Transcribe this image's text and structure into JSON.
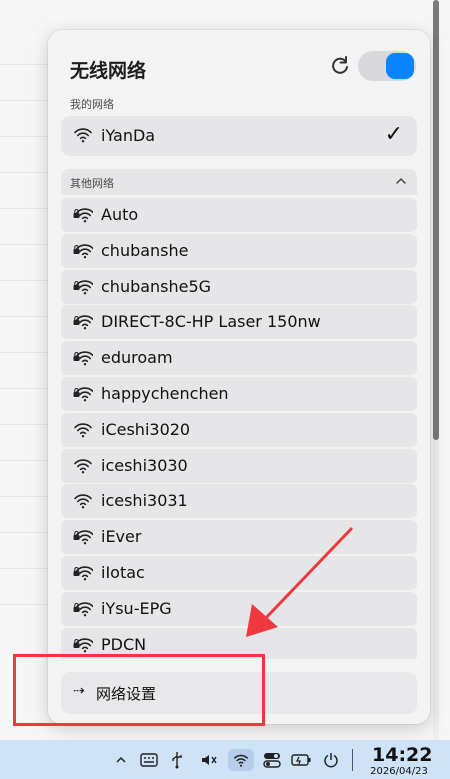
{
  "panel": {
    "title": "无线网络",
    "wifi_enabled": true,
    "accent_color": "#0a84ff"
  },
  "my_networks": {
    "label": "我的网络",
    "items": [
      {
        "name": "iYanDa",
        "connected": true,
        "secured": false
      }
    ]
  },
  "other_networks": {
    "label": "其他网络",
    "collapsed": false,
    "items": [
      {
        "name": "Auto",
        "secured": true
      },
      {
        "name": "chubanshe",
        "secured": true
      },
      {
        "name": "chubanshe5G",
        "secured": true
      },
      {
        "name": "DIRECT-8C-HP Laser 150nw",
        "secured": true
      },
      {
        "name": "eduroam",
        "secured": true
      },
      {
        "name": "happychenchen",
        "secured": true
      },
      {
        "name": "iCeshi3020",
        "secured": false
      },
      {
        "name": "iceshi3030",
        "secured": false
      },
      {
        "name": "iceshi3031",
        "secured": false
      },
      {
        "name": "iEver",
        "secured": true
      },
      {
        "name": "iIotac",
        "secured": true
      },
      {
        "name": "iYsu-EPG",
        "secured": true
      },
      {
        "name": "PDCN",
        "secured": true
      }
    ]
  },
  "settings": {
    "arrow": "⇢",
    "label": "网络设置"
  },
  "taskbar": {
    "time": "14:22",
    "date": "2026/04/23"
  },
  "annotation_color": "#f0393c"
}
